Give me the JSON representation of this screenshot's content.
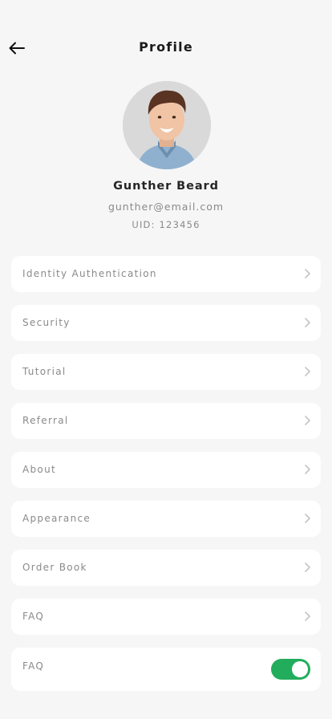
{
  "header": {
    "title": "Profile"
  },
  "user": {
    "name": "Gunther Beard",
    "email": "gunther@email.com",
    "uid": "UID: 123456"
  },
  "menu": {
    "items": [
      {
        "label": "Identity Authentication",
        "icon": "chevron-right-icon"
      },
      {
        "label": "Security",
        "icon": "chevron-right-icon"
      },
      {
        "label": "Tutorial",
        "icon": "chevron-right-icon"
      },
      {
        "label": "Referral",
        "icon": "chevron-right-icon"
      },
      {
        "label": "About",
        "icon": "chevron-right-icon"
      },
      {
        "label": "Appearance",
        "icon": "chevron-right-icon"
      },
      {
        "label": "Order Book",
        "icon": "chevron-right-icon"
      },
      {
        "label": "FAQ",
        "icon": "chevron-right-icon"
      }
    ],
    "toggle_item": {
      "label": "FAQ",
      "enabled": true
    }
  },
  "colors": {
    "background": "#f6f6f7",
    "card": "#ffffff",
    "toggle_on": "#22ad5c",
    "text_dark": "#1b1b1b",
    "text_muted": "#8a8a8a",
    "chevron": "#c4c4c4"
  }
}
